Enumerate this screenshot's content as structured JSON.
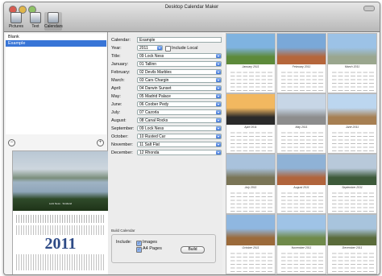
{
  "window": {
    "title": "Desktop Calendar Maker"
  },
  "toolbar": {
    "items": [
      {
        "label": "Pictures",
        "icon": "pictures-icon"
      },
      {
        "label": "Text",
        "icon": "text-icon"
      },
      {
        "label": "Calendars",
        "icon": "calendars-icon"
      }
    ]
  },
  "sidebar": {
    "items": [
      "Blank",
      "Example"
    ],
    "selected": "Example",
    "add_label": "+",
    "remove_label": "−",
    "preview": {
      "caption": "Lock Ness · Scotland",
      "year": "2011"
    }
  },
  "form": {
    "calendar_label": "Calendar:",
    "calendar_value": "Example",
    "year_label": "Year:",
    "year_value": "2011",
    "include_local_label": "Include Local",
    "title_label": "Title:",
    "title_value": "09 Lock Ness",
    "months": [
      {
        "label": "January:",
        "value": "01 Tallinn"
      },
      {
        "label": "February:",
        "value": "02 Devils Marbles"
      },
      {
        "label": "March:",
        "value": "03 Cars Chargin"
      },
      {
        "label": "April:",
        "value": "04 Darwin Sunset"
      },
      {
        "label": "May:",
        "value": "05 Madrid Palace"
      },
      {
        "label": "June:",
        "value": "06 Coober Pedy"
      },
      {
        "label": "July:",
        "value": "07 Cazorla"
      },
      {
        "label": "August:",
        "value": "08 Canal Rocks"
      },
      {
        "label": "September:",
        "value": "09 Lock Ness"
      },
      {
        "label": "October:",
        "value": "10 Rusted Car"
      },
      {
        "label": "November:",
        "value": "11 Salt Flat"
      },
      {
        "label": "December:",
        "value": "12 Rhonda"
      }
    ],
    "build_group_title": "Build Calendar",
    "include_label": "Include:",
    "images_label": "Images",
    "a4_label": "A4 Pages",
    "build_label": "Build"
  },
  "calendar_grid": [
    {
      "name": "January 2011",
      "colors": [
        "#7fb3e0",
        "#5d8a3a"
      ]
    },
    {
      "name": "February 2011",
      "colors": [
        "#7aa8d8",
        "#b5663b"
      ]
    },
    {
      "name": "March 2011",
      "colors": [
        "#9cc2e6",
        "#9aa68e"
      ]
    },
    {
      "name": "April 2011",
      "colors": [
        "#f2b860",
        "#2a2a2a"
      ]
    },
    {
      "name": "May 2011",
      "colors": [
        "#c7d6e6",
        "#8d8d8d"
      ]
    },
    {
      "name": "June 2011",
      "colors": [
        "#bcd6ef",
        "#a67f52"
      ]
    },
    {
      "name": "July 2011",
      "colors": [
        "#a9c2dc",
        "#7a7557"
      ]
    },
    {
      "name": "August 2011",
      "colors": [
        "#8fb2d6",
        "#b0643c"
      ]
    },
    {
      "name": "September 2011",
      "colors": [
        "#b8c9da",
        "#3d5a3a"
      ]
    },
    {
      "name": "October 2011",
      "colors": [
        "#8fb7e0",
        "#9b6a3a"
      ]
    },
    {
      "name": "November 2011",
      "colors": [
        "#9fc3e6",
        "#6f8a4a"
      ]
    },
    {
      "name": "December 2011",
      "colors": [
        "#a8c4dd",
        "#5a6b3a"
      ]
    }
  ]
}
